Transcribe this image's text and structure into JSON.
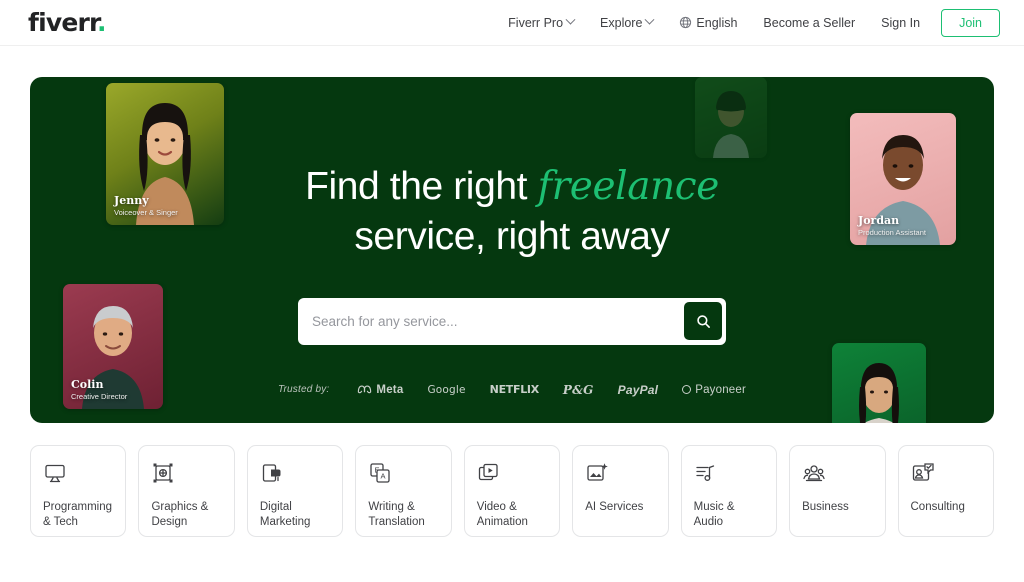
{
  "header": {
    "logo": "fiverr",
    "logo_dot": ".",
    "nav": [
      {
        "label": "Fiverr Pro",
        "has_chevron": true
      },
      {
        "label": "Explore",
        "has_chevron": true
      },
      {
        "label": "English",
        "icon": "globe-icon",
        "has_chevron": false
      },
      {
        "label": "Become a Seller",
        "has_chevron": false
      },
      {
        "label": "Sign In",
        "has_chevron": false
      }
    ],
    "join_label": "Join"
  },
  "hero": {
    "headline_part1": "Find the right ",
    "headline_accent": "freelance",
    "headline_part2": "service, right away",
    "search": {
      "placeholder": "Search for any service...",
      "value": "",
      "button_icon": "search-icon"
    },
    "trusted": {
      "label": "Trusted by:",
      "brands": [
        "Meta",
        "Google",
        "NETFLIX",
        "P&G",
        "PayPal",
        "Payoneer"
      ]
    },
    "background_color": "#05380f",
    "accent_color": "#1dbf73",
    "profile_cards": [
      {
        "name": "Jenny",
        "role": "Voiceover & Singer",
        "bg": "#7d8c1e"
      },
      {
        "name": "Colin",
        "role": "Creative Director",
        "bg": "#8e3247"
      },
      {
        "name": "Jordan",
        "role": "Production Assistant",
        "bg": "#f0b3b3"
      },
      {
        "name": "",
        "role": "",
        "bg": "#2a6b2e"
      },
      {
        "name": "",
        "role": "",
        "bg": "#0c7a34"
      }
    ]
  },
  "categories": [
    {
      "label": "Programming\n& Tech",
      "icon": "monitor-icon"
    },
    {
      "label": "Graphics &\nDesign",
      "icon": "design-frame-icon"
    },
    {
      "label": "Digital\nMarketing",
      "icon": "megaphone-screen-icon"
    },
    {
      "label": "Writing &\nTranslation",
      "icon": "translate-icon"
    },
    {
      "label": "Video &\nAnimation",
      "icon": "video-play-icon"
    },
    {
      "label": "AI Services",
      "icon": "ai-image-sparkle-icon"
    },
    {
      "label": "Music & Audio",
      "icon": "music-note-icon"
    },
    {
      "label": "Business",
      "icon": "people-group-icon"
    },
    {
      "label": "Consulting",
      "icon": "consulting-person-icon"
    }
  ]
}
